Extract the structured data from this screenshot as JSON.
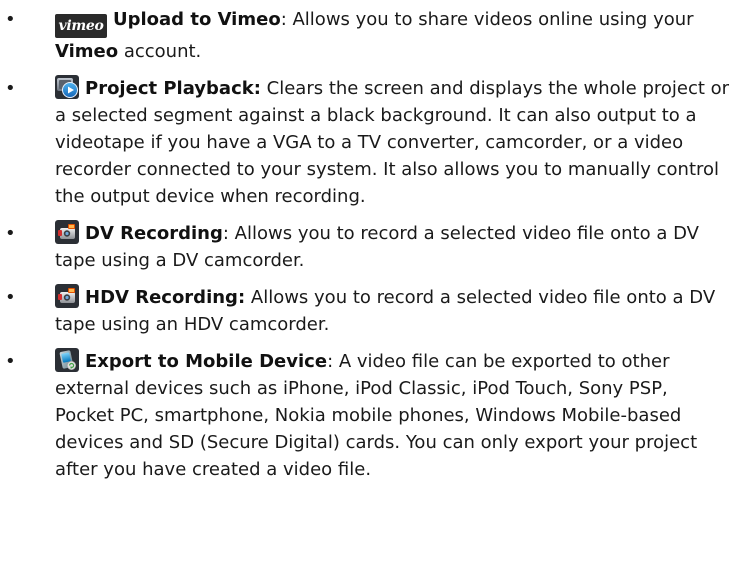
{
  "items": [
    {
      "icon": "vimeo-logo-icon",
      "icon_text": "vimeo",
      "title": "Upload to Vimeo",
      "sep": ": ",
      "text_a": "Allows you to share videos online using your ",
      "bold_mid": "Vimeo",
      "text_b": " account."
    },
    {
      "icon": "playback-icon",
      "title": "Project Playback:",
      "sep": " ",
      "text": "Clears the screen and displays the whole project or a selected segment against a black background. It can also output to a videotape if you have a VGA to a TV converter, camcorder, or a video recorder connected to your system. It also allows you to manually control the output device when recording."
    },
    {
      "icon": "camcorder-icon",
      "title": "DV Recording",
      "sep": ": ",
      "text": "Allows you to record a selected video file onto a DV tape using a DV camcorder."
    },
    {
      "icon": "camcorder-icon",
      "title": "HDV Recording:",
      "sep": " ",
      "text": "Allows you to record a selected video file onto a DV tape using an HDV camcorder."
    },
    {
      "icon": "mobile-device-icon",
      "title": "Export to Mobile Device",
      "sep": ": ",
      "text": "A video file can be exported to other external devices such as iPhone, iPod Classic, iPod Touch, Sony PSP, Pocket PC, smartphone, Nokia mobile phones, Windows Mobile-based devices and SD (Secure Digital) cards. You can only export your project after you have created a video file."
    }
  ],
  "bullet_char": "•"
}
